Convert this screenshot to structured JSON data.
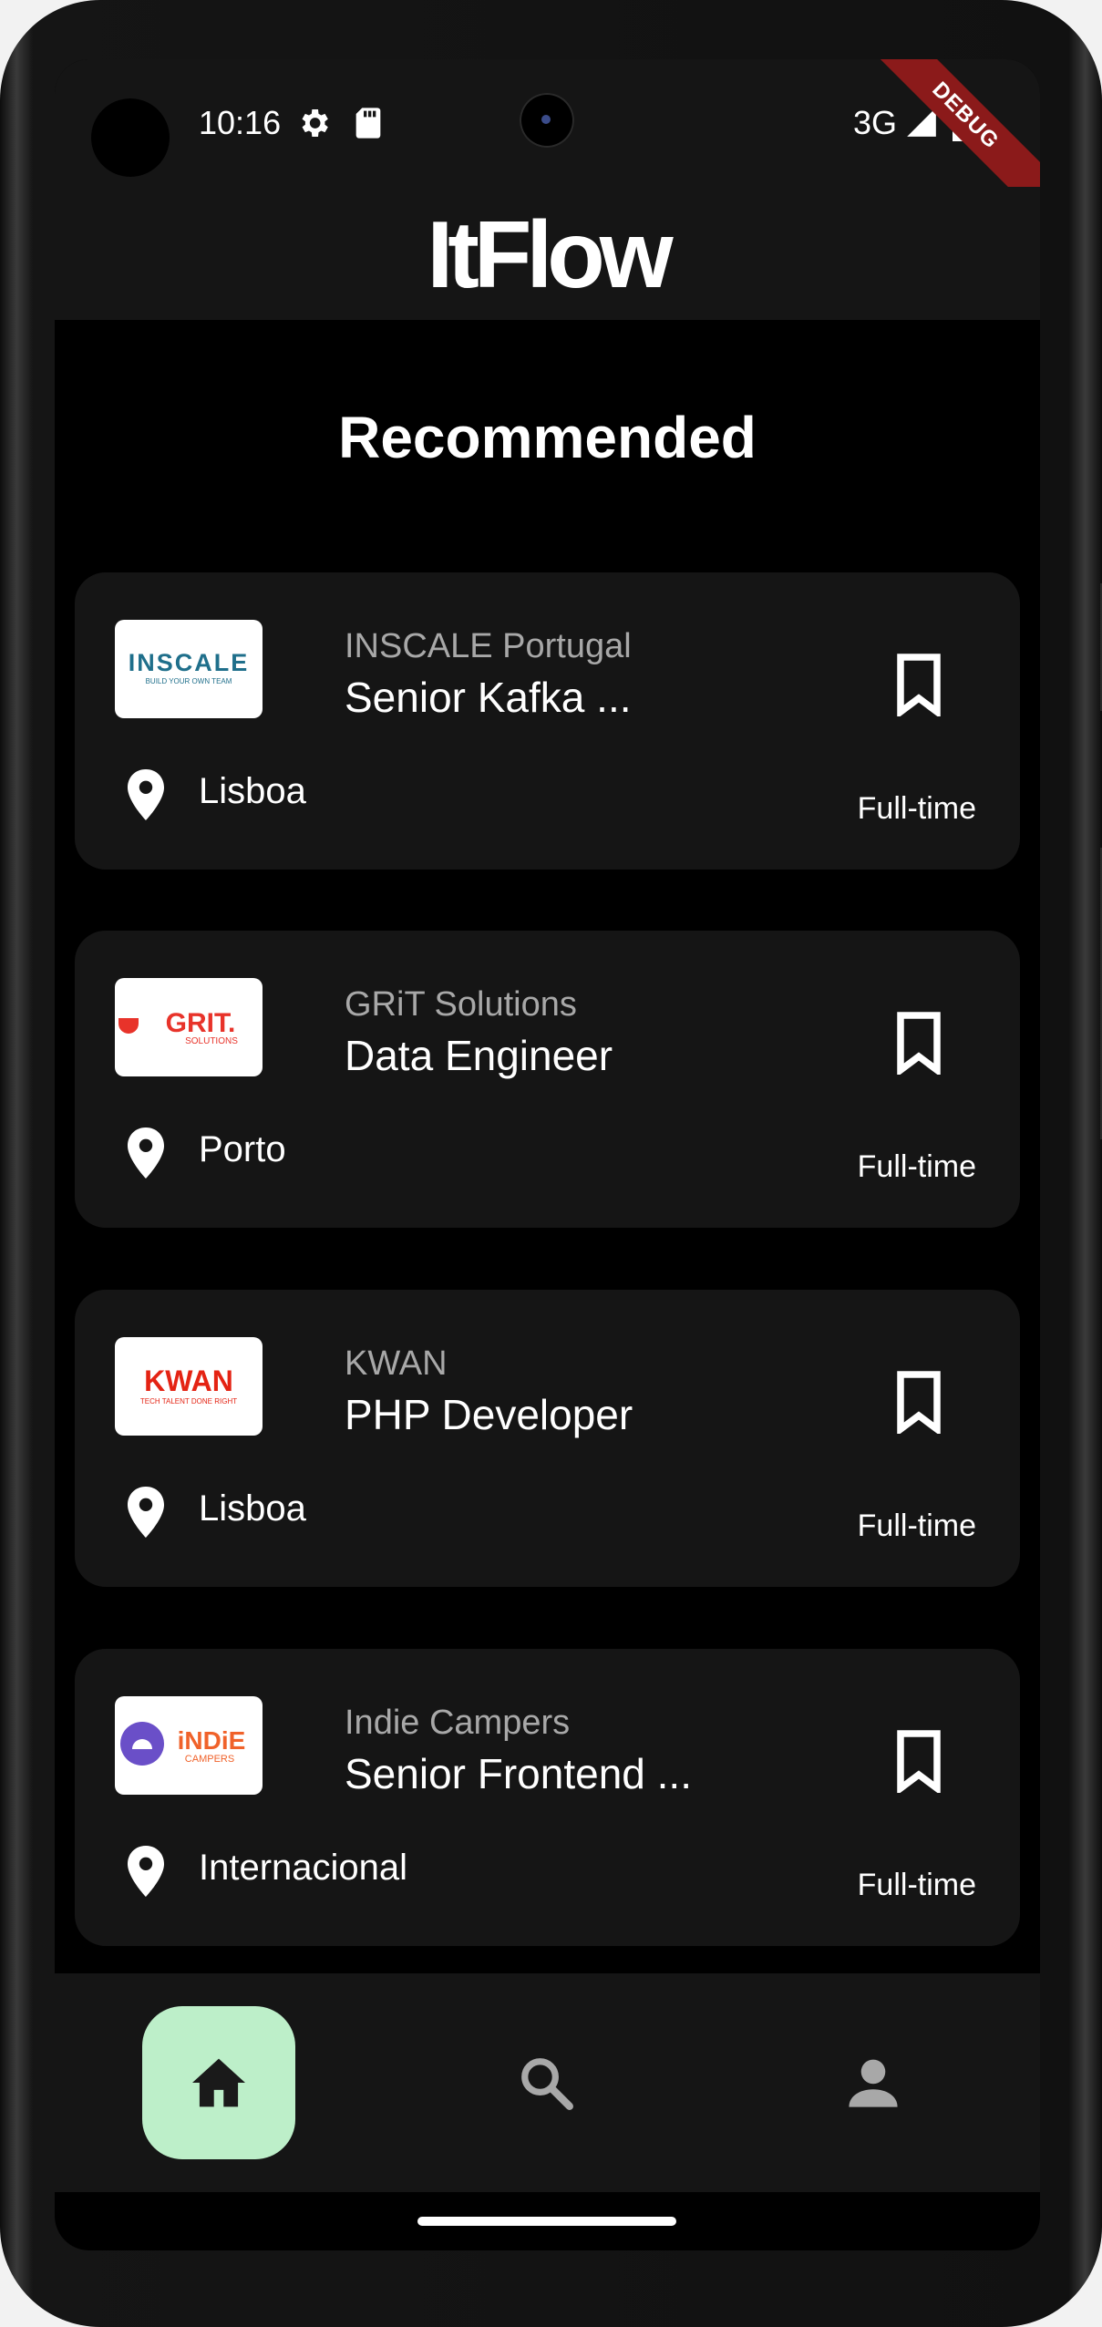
{
  "status_bar": {
    "time": "10:16",
    "network": "3G",
    "debug_label": "DEBUG",
    "icons": [
      "settings-icon",
      "sd-card-icon",
      "signal-icon",
      "battery-icon"
    ]
  },
  "app": {
    "title": "ItFlow"
  },
  "section_title": "Recommended",
  "jobs": [
    {
      "company": "INSCALE Portugal",
      "title": "Senior Kafka ...",
      "location": "Lisboa",
      "type": "Full-time",
      "logo": {
        "main": "INSCALE",
        "tagline": "BUILD YOUR OWN TEAM",
        "color": "#1f6f8b"
      }
    },
    {
      "company": "GRiT Solutions",
      "title": "Data Engineer",
      "location": "Porto",
      "type": "Full-time",
      "logo": {
        "main": "GRIT.",
        "tagline": "SOLUTIONS",
        "color": "#e8332a"
      }
    },
    {
      "company": "KWAN",
      "title": "PHP Developer",
      "location": "Lisboa",
      "type": "Full-time",
      "logo": {
        "main": "KWAN",
        "tagline": "TECH TALENT DONE RIGHT",
        "color": "#e42313"
      }
    },
    {
      "company": "Indie Campers",
      "title": "Senior Frontend ...",
      "location": "Internacional",
      "type": "Full-time",
      "logo": {
        "main": "iNDiE",
        "tagline": "CAMPERS",
        "color": "#f0622a",
        "accent": "#6a4fc8"
      }
    }
  ],
  "bottom_nav": {
    "items": [
      {
        "icon": "home-icon",
        "active": true
      },
      {
        "icon": "search-icon",
        "active": false
      },
      {
        "icon": "profile-icon",
        "active": false
      }
    ],
    "active_bg": "#bdefc9"
  },
  "colors": {
    "background": "#000000",
    "card": "#151515",
    "text": "#ffffff",
    "muted": "#a8a8a8"
  }
}
